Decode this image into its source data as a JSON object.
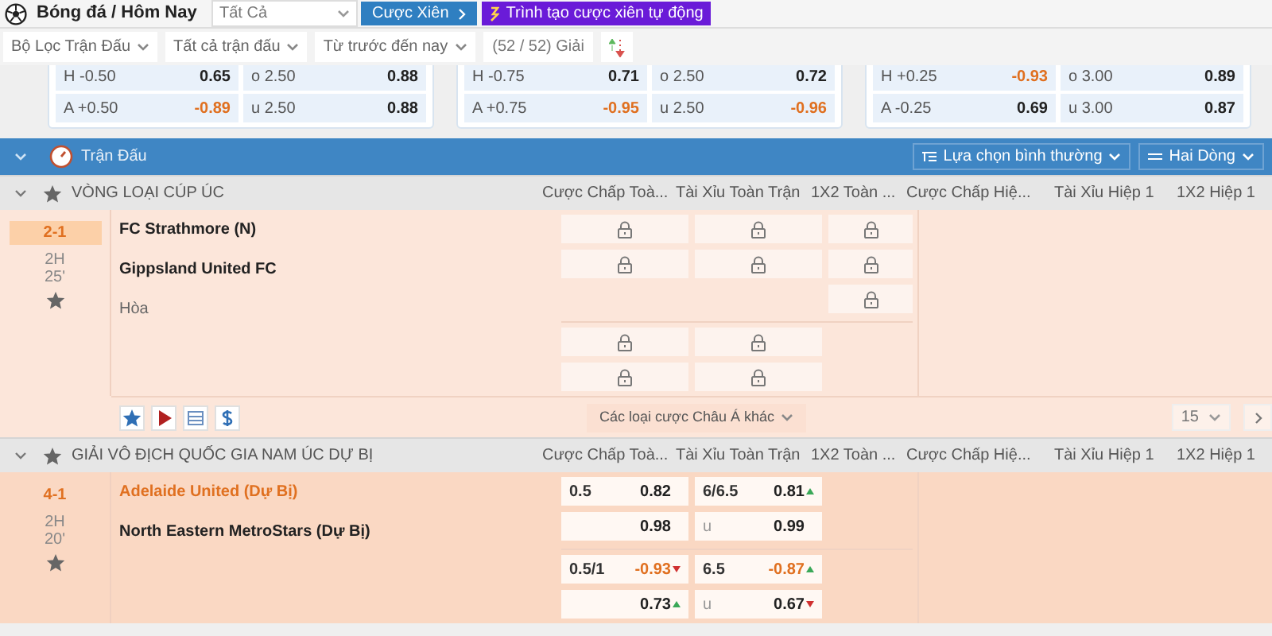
{
  "top_bar": {
    "breadcrumb": "Bóng đá / Hôm Nay",
    "filter": "Tất Cả",
    "parlay_button": "Cược Xiên",
    "auto_parlay_button": "Trình tạo cược xiên tự động"
  },
  "filters": [
    "Bộ Lọc Trận Đấu",
    "Tất cả trận đấu",
    "Từ trước đến nay"
  ],
  "league_count": "(52 / 52) Giải",
  "odds_cards": [
    {
      "rows": [
        [
          {
            "label": "H -0.50",
            "value": "0.65",
            "negative": false
          },
          {
            "label": "o 2.50",
            "value": "0.88",
            "negative": false
          }
        ],
        [
          {
            "label": "A +0.50",
            "value": "-0.89",
            "negative": true
          },
          {
            "label": "u 2.50",
            "value": "0.88",
            "negative": false
          }
        ]
      ]
    },
    {
      "rows": [
        [
          {
            "label": "H -0.75",
            "value": "0.71",
            "negative": false
          },
          {
            "label": "o 2.50",
            "value": "0.72",
            "negative": false
          }
        ],
        [
          {
            "label": "A +0.75",
            "value": "-0.95",
            "negative": true
          },
          {
            "label": "u 2.50",
            "value": "-0.96",
            "negative": true
          }
        ]
      ]
    },
    {
      "rows": [
        [
          {
            "label": "H +0.25",
            "value": "-0.93",
            "negative": true
          },
          {
            "label": "o 3.00",
            "value": "0.89",
            "negative": false
          }
        ],
        [
          {
            "label": "A -0.25",
            "value": "0.69",
            "negative": false
          },
          {
            "label": "u 3.00",
            "value": "0.87",
            "negative": false
          }
        ]
      ]
    }
  ],
  "section": {
    "title": "Trận Đấu",
    "expanded": true,
    "view_buttons": [
      "Lựa chọn bình thường",
      "Hai Dòng"
    ]
  },
  "leagues": [
    {
      "name": "VÒNG LOẠI CÚP ÚC",
      "expanded": true,
      "columns": [
        "Cược Chấp Toà...",
        "Tài Xỉu Toàn Trận",
        "1X2 Toàn ...",
        "Cược Chấp Hiệ...",
        "Tài Xỉu Hiệp 1",
        "1X2 Hiệp 1"
      ],
      "matches": [
        {
          "score": "2-1",
          "score_highlighted": true,
          "period": "2H",
          "minute": "25'",
          "favorite": false,
          "home": {
            "name": "FC Strathmore (N)",
            "highlighted": false
          },
          "away": {
            "name": "Gippsland United FC",
            "highlighted": false
          },
          "draw": "Hòa",
          "groups": [
            {
              "handicap": [
                {
                  "kind": "lock"
                },
                {
                  "kind": "lock"
                }
              ],
              "over_under": [
                {
                  "kind": "lock"
                },
                {
                  "kind": "lock"
                }
              ],
              "one_x_two": [
                {
                  "kind": "lock"
                },
                {
                  "kind": "lock"
                },
                {
                  "kind": "lock"
                }
              ]
            },
            {
              "handicap": [
                {
                  "kind": "lock"
                },
                {
                  "kind": "lock"
                }
              ],
              "over_under": [
                {
                  "kind": "lock"
                },
                {
                  "kind": "lock"
                }
              ]
            }
          ],
          "footer": {
            "more_markets": "Các loại cược Châu Á khác",
            "page_size": "15"
          }
        }
      ]
    },
    {
      "name": "GIẢI VÔ ĐỊCH QUỐC GIA NAM ÚC DỰ BỊ",
      "expanded": true,
      "columns": [
        "Cược Chấp Toà...",
        "Tài Xỉu Toàn Trận",
        "1X2 Toàn ...",
        "Cược Chấp Hiệ...",
        "Tài Xỉu Hiệp 1",
        "1X2 Hiệp 1"
      ],
      "matches": [
        {
          "score": "4-1",
          "score_highlighted": false,
          "period": "2H",
          "minute": "20'",
          "favorite": false,
          "home": {
            "name": "Adelaide United (Dự Bị)",
            "highlighted": true
          },
          "away": {
            "name": "North Eastern MetroStars (Dự Bị)",
            "highlighted": false
          },
          "groups": [
            {
              "handicap": [
                {
                  "kind": "odds",
                  "label": "0.5",
                  "value": "0.82",
                  "negative": false
                },
                {
                  "kind": "odds",
                  "value": "0.98",
                  "negative": false
                }
              ],
              "over_under": [
                {
                  "kind": "odds",
                  "label": "6/6.5",
                  "value": "0.81",
                  "negative": false,
                  "odds_up": true
                },
                {
                  "kind": "odds",
                  "label": "u",
                  "value": "0.99",
                  "negative": false
                }
              ]
            },
            {
              "handicap": [
                {
                  "kind": "odds",
                  "label": "0.5/1",
                  "value": "-0.93",
                  "negative": true,
                  "odds_down": true
                },
                {
                  "kind": "odds",
                  "value": "0.73",
                  "negative": false,
                  "odds_up": true
                }
              ],
              "over_under": [
                {
                  "kind": "odds",
                  "label": "6.5",
                  "value": "-0.87",
                  "negative": true,
                  "odds_up": true
                },
                {
                  "kind": "odds",
                  "label": "u",
                  "value": "0.67",
                  "negative": false,
                  "odds_down": true
                }
              ]
            }
          ]
        }
      ]
    }
  ]
}
